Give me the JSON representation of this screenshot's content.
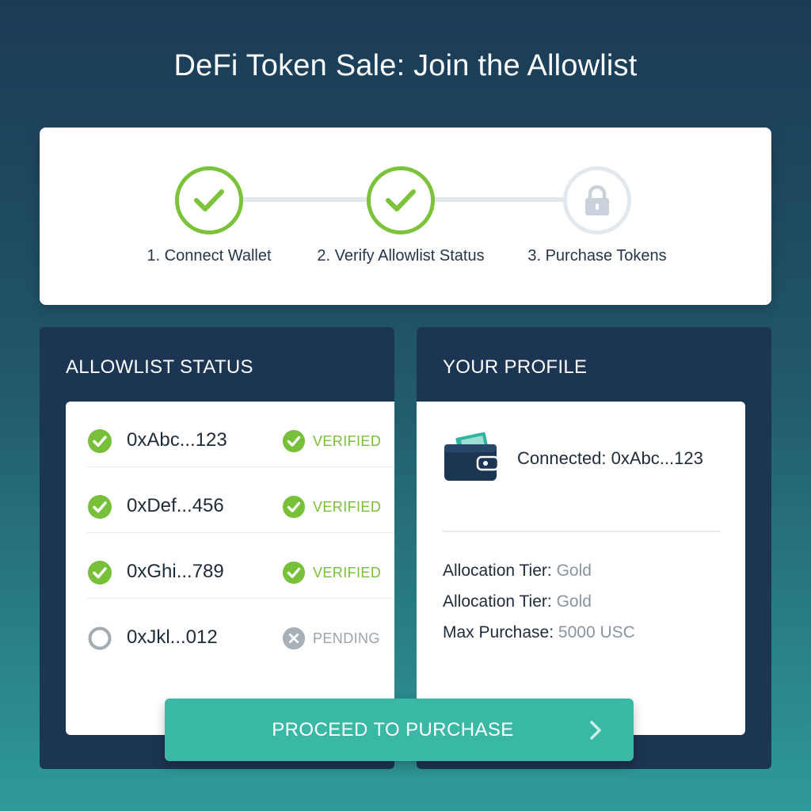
{
  "page": {
    "title": "DeFi Token Sale: Join the Allowlist"
  },
  "steps": [
    {
      "label": "1. Connect Wallet",
      "state": "complete",
      "icon": "check-icon"
    },
    {
      "label": "2. Verify Allowlist Status",
      "state": "complete",
      "icon": "check-icon"
    },
    {
      "label": "3. Purchase Tokens",
      "state": "locked",
      "icon": "lock-icon"
    }
  ],
  "allowlist": {
    "heading": "ALLOWLIST STATUS",
    "entries": [
      {
        "address": "0xAbc...123",
        "status": "VERIFIED"
      },
      {
        "address": "0xDef...456",
        "status": "VERIFIED"
      },
      {
        "address": "0xGhi...789",
        "status": "VERIFIED"
      },
      {
        "address": "0xJkl...012",
        "status": "PENDING"
      }
    ]
  },
  "profile": {
    "heading": "YOUR PROFILE",
    "connected": "Connected: 0xAbc...123",
    "lines": [
      {
        "label": "Allocation Tier: ",
        "value": "Gold"
      },
      {
        "label": "Allocation Tier: ",
        "value": "Gold"
      },
      {
        "label": "Max Purchase: ",
        "value": "5000 USC"
      }
    ]
  },
  "cta": {
    "label": "PROCEED TO PURCHASE"
  },
  "colors": {
    "accent_green": "#7cc23a",
    "teal_button": "#39b8a6",
    "panel_navy": "#1c3552",
    "pending_grey": "#9aa3ab"
  }
}
